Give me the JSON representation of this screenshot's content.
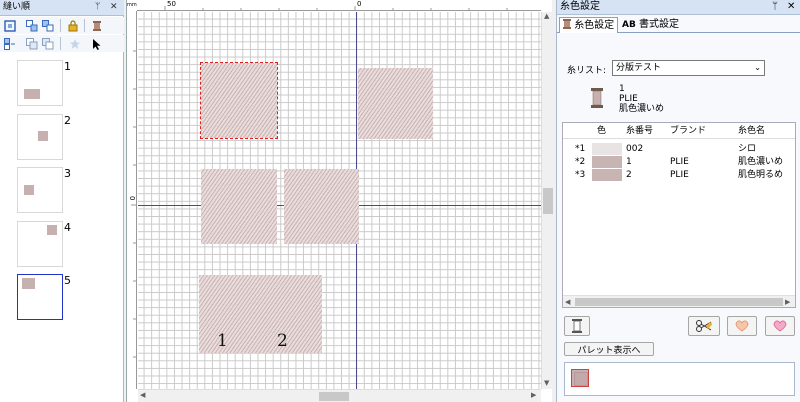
{
  "left_panel": {
    "title": "縫い順",
    "pin": "ᛘ",
    "close": "✕",
    "items": [
      {
        "number": "1"
      },
      {
        "number": "2"
      },
      {
        "number": "3"
      },
      {
        "number": "4"
      },
      {
        "number": "5"
      }
    ]
  },
  "ruler": {
    "unit": "mm",
    "h_labels": [
      "50",
      "0"
    ],
    "v_labels": [
      "0"
    ]
  },
  "canvas": {
    "labels": [
      "1",
      "2"
    ]
  },
  "right_panel": {
    "title": "糸色設定",
    "pin": "ᛘ",
    "close": "✕",
    "tabs": [
      {
        "label": "糸色設定",
        "active": true
      },
      {
        "label": "書式設定",
        "active": false
      }
    ],
    "tab_prefix": "AB",
    "thread_list_label": "糸リスト:",
    "thread_list_value": "分版テスト",
    "current": {
      "number": "1",
      "brand": "PLIE",
      "name": "肌色濃いめ"
    },
    "table": {
      "headers": [
        "色",
        "糸番号",
        "ブランド",
        "糸色名"
      ],
      "rows": [
        {
          "id": "*1",
          "color": "#e9e4e4",
          "number": "002",
          "brand": "",
          "name": "シロ"
        },
        {
          "id": "*2",
          "color": "#c9b4b4",
          "number": "1",
          "brand": "PLIE",
          "name": "肌色濃いめ"
        },
        {
          "id": "*3",
          "color": "#c9b4b4",
          "number": "2",
          "brand": "PLIE",
          "name": "肌色明るめ"
        }
      ]
    },
    "palette_button": "パレット表示へ"
  },
  "colors": {
    "panel_title_bg": "#d5e3f5",
    "patch": "#dccaca",
    "selection": "#e02020",
    "axis": "#4a4a8a",
    "selected_thumb_border": "#2233cc"
  }
}
